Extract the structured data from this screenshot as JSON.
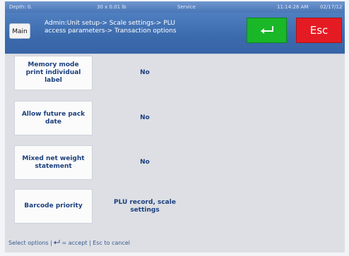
{
  "status_bar": {
    "left": "Depth: 0.",
    "weight": "30 x 0.01 lb",
    "mode": "Service",
    "time": "11:14:26 AM",
    "date": "02/17/12"
  },
  "header": {
    "main_label": "Main",
    "breadcrumb_line1": "Admin:Unit setup-> Scale settings-> PLU",
    "breadcrumb_line2": "access parameters-> Transaction options",
    "enter_icon": "enter-arrow-icon",
    "esc_label": "Esc"
  },
  "options": [
    {
      "label": "Memory mode print individual label",
      "value": "No"
    },
    {
      "label": "Allow future pack date",
      "value": "No"
    },
    {
      "label": "Mixed net weight statement",
      "value": "No"
    },
    {
      "label": "Barcode priority",
      "value": "PLU record, scale settings"
    }
  ],
  "hint": {
    "prefix": "Select options | ",
    "accept": "= accept | Esc to cancel"
  },
  "colors": {
    "enter": "#1ab728",
    "esc": "#e51b23",
    "header": "#3b6aac"
  }
}
